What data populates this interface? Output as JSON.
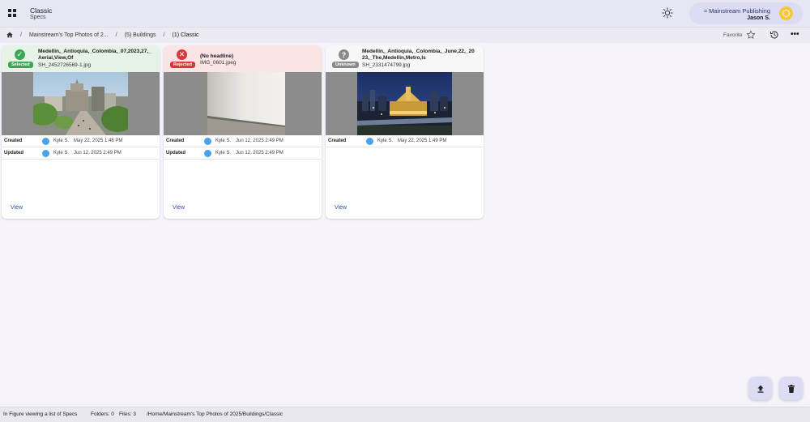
{
  "header": {
    "title": "Classic",
    "subtitle": "Specs",
    "org": "≈ Mainstream Publishing",
    "user": "Jason S."
  },
  "breadcrumb": {
    "items": [
      "Mainstream's Top Photos of 2...",
      "(5) Buildings",
      "(1) Classic"
    ]
  },
  "toolbar": {
    "favorite_label": "Favorite"
  },
  "cards": [
    {
      "status": "Selected",
      "status_color": "#3aa857",
      "head_bg": "#e6f3e6",
      "title": "Medellin,_Antioquia,_Colombia,_07,2023,27,_Aerial,View,Of",
      "file": "SH_2452726569-1.jpg",
      "rows": [
        {
          "label": "Created",
          "user": "Kyle S.",
          "date": "May 22, 2025 1:48 PM"
        },
        {
          "label": "Updated",
          "user": "Kyle S.",
          "date": "Jun 12, 2025 2:49 PM"
        }
      ],
      "view_label": "View"
    },
    {
      "status": "Rejected",
      "status_color": "#d9383a",
      "head_bg": "#fbe4e6",
      "title": "(No headline)",
      "file": "IMG_0601.jpeg",
      "rows": [
        {
          "label": "Created",
          "user": "Kyle S.",
          "date": "Jun 12, 2025 2:49 PM"
        },
        {
          "label": "Updated",
          "user": "Kyle S.",
          "date": "Jun 12, 2025 2:49 PM"
        }
      ],
      "view_label": "View"
    },
    {
      "status": "Unknown",
      "status_color": "#8a8a8a",
      "head_bg": "#f7f7f7",
      "title": "Medellin,_Antioquia,_Colombia,_June,22,_2023,_The,Medellin,Metro,Is",
      "file": "SH_2331474799.jpg",
      "rows": [
        {
          "label": "Created",
          "user": "Kyle S.",
          "date": "May 22, 2025 1:49 PM"
        }
      ],
      "view_label": "View"
    }
  ],
  "statusbar": {
    "context": "In Figure viewing a list of Specs",
    "folders": "Folders: 0",
    "files": "Files: 3",
    "path": "/Home/Mainstream's Top Photos of 2025/Buildings/Classic"
  },
  "icons": {
    "apps": "apps-icon",
    "theme": "sun-icon",
    "home": "home-icon",
    "favorite": "star-outline-icon",
    "history": "history-icon",
    "more": "more-horizontal-icon",
    "upload": "upload-icon",
    "delete": "trash-icon"
  }
}
